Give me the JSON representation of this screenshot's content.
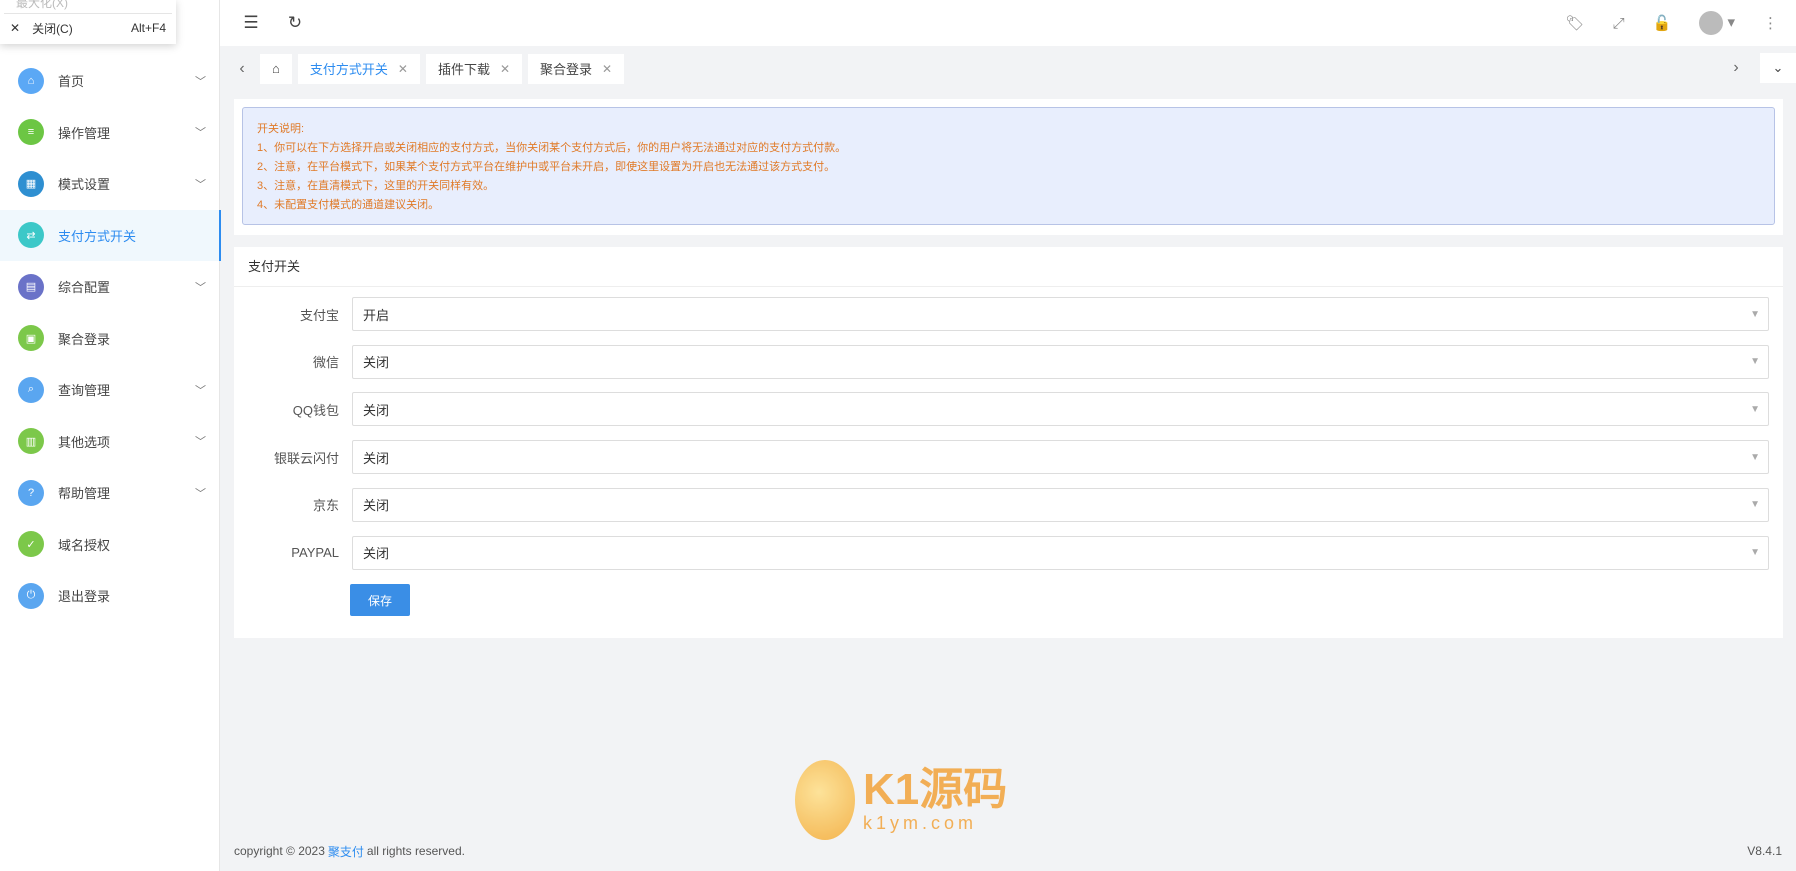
{
  "window_menu": {
    "prev_item": "最大化(X)",
    "close_label": "关闭(C)",
    "close_shortcut": "Alt+F4"
  },
  "sidebar": {
    "items": [
      {
        "label": "首页",
        "icon": "home-icon",
        "color": "#5ba8f5",
        "expandable": true
      },
      {
        "label": "操作管理",
        "icon": "sliders-icon",
        "color": "#6cc644",
        "expandable": true
      },
      {
        "label": "模式设置",
        "icon": "grid-icon",
        "color": "#2e8fd1",
        "expandable": true
      },
      {
        "label": "支付方式开关",
        "icon": "toggle-icon",
        "color": "#3cc8c8",
        "expandable": false,
        "active": true
      },
      {
        "label": "综合配置",
        "icon": "config-icon",
        "color": "#6a72c8",
        "expandable": true
      },
      {
        "label": "聚合登录",
        "icon": "login-icon",
        "color": "#7cc84a",
        "expandable": false
      },
      {
        "label": "查询管理",
        "icon": "search-icon",
        "color": "#5aa6f0",
        "expandable": true
      },
      {
        "label": "其他选项",
        "icon": "options-icon",
        "color": "#7cc84a",
        "expandable": true
      },
      {
        "label": "帮助管理",
        "icon": "help-icon",
        "color": "#5aa6f0",
        "expandable": true
      },
      {
        "label": "域名授权",
        "icon": "shield-icon",
        "color": "#7cc84a",
        "expandable": false
      },
      {
        "label": "退出登录",
        "icon": "power-icon",
        "color": "#5aa6f0",
        "expandable": false
      }
    ]
  },
  "tabs": [
    {
      "label": "支付方式开关",
      "active": true
    },
    {
      "label": "插件下载"
    },
    {
      "label": "聚合登录"
    }
  ],
  "notice": {
    "title": "开关说明:",
    "lines": [
      "1、你可以在下方选择开启或关闭相应的支付方式，当你关闭某个支付方式后，你的用户将无法通过对应的支付方式付款。",
      "2、注意，在平台模式下，如果某个支付方式平台在维护中或平台未开启，即使这里设置为开启也无法通过该方式支付。",
      "3、注意，在直清模式下，这里的开关同样有效。",
      "4、未配置支付模式的通道建议关闭。"
    ]
  },
  "form": {
    "title": "支付开关",
    "fields": [
      {
        "label": "支付宝",
        "value": "开启"
      },
      {
        "label": "微信",
        "value": "关闭"
      },
      {
        "label": "QQ钱包",
        "value": "关闭"
      },
      {
        "label": "银联云闪付",
        "value": "关闭"
      },
      {
        "label": "京东",
        "value": "关闭"
      },
      {
        "label": "PAYPAL",
        "value": "关闭"
      }
    ],
    "save_label": "保存"
  },
  "footer": {
    "prefix": "copyright © 2023",
    "brand": "聚支付",
    "suffix": "all rights reserved.",
    "version": "V8.4.1"
  },
  "watermark": {
    "name": "K1源码",
    "url": "k1ym.com"
  }
}
